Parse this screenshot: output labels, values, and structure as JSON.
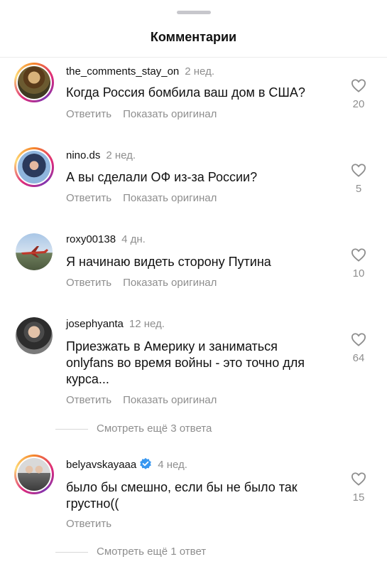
{
  "header": {
    "title": "Комментарии"
  },
  "actions": {
    "reply": "Ответить",
    "show_original": "Показать оригинал"
  },
  "comments": [
    {
      "user": "the_comments_stay_on",
      "time": "2 нед.",
      "text": "Когда Россия бомбила ваш дом в США?",
      "likes": "20",
      "avatar_icon": "painting-avatar",
      "avatar_ring": true
    },
    {
      "user": "nino.ds",
      "time": "2 нед.",
      "text": "А вы сделали ОФ из-за России?",
      "likes": "5",
      "avatar_icon": "person-avatar",
      "avatar_ring": true
    },
    {
      "user": "roxy00138",
      "time": "4 дн.",
      "text": "Я начинаю видеть сторону Путина",
      "likes": "10",
      "avatar_icon": "airplane-avatar",
      "avatar_ring": false
    },
    {
      "user": "josephyanta",
      "time": "12 нед.",
      "text": "Приезжать в Америку и заниматься onlyfans во время войны - это точно для курса...",
      "likes": "64",
      "avatar_icon": "person-avatar",
      "avatar_ring": false
    },
    {
      "user": "belyavskayaaa",
      "time": "4 нед.",
      "text": "было бы смешно, если бы не было так грустно((",
      "likes": "15",
      "avatar_icon": "couple-avatar",
      "avatar_ring": true,
      "verified": true
    }
  ],
  "more_replies": [
    {
      "label": "Смотреть ещё 3 ответа"
    },
    {
      "label": "Смотреть ещё 1 ответ"
    }
  ],
  "colors": {
    "muted": "#8e8e8e",
    "verified": "#3897f0",
    "ring_start": "#f58529",
    "ring_end": "#dd2a7b"
  }
}
